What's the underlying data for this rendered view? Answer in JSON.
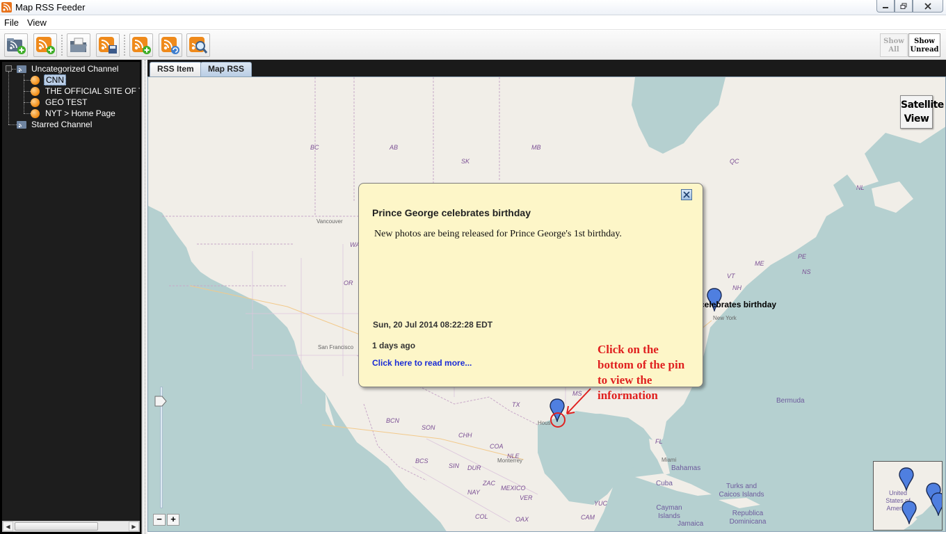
{
  "window": {
    "title": "Map RSS Feeder",
    "controls": [
      "minimize",
      "restore",
      "close"
    ]
  },
  "menu": [
    "File",
    "View"
  ],
  "toolbar": {
    "buttons": [
      {
        "icon": "add-channel-icon"
      },
      {
        "icon": "add-feed-icon"
      },
      {
        "icon": "open-folder-icon"
      },
      {
        "icon": "save-feed-icon"
      },
      {
        "icon": "feed-add-item-icon"
      },
      {
        "icon": "refresh-feed-icon"
      },
      {
        "icon": "search-feed-icon"
      }
    ],
    "show_all": "Show All",
    "show_unread": "Show Unread"
  },
  "tree": {
    "channels": [
      {
        "label": "Uncategorized Channel",
        "feeds": [
          "CNN",
          "THE OFFICIAL SITE OF T",
          "GEO TEST",
          "NYT > Home Page"
        ]
      },
      {
        "label": "Starred Channel",
        "feeds": []
      }
    ],
    "selected": "CNN"
  },
  "tabs": [
    {
      "label": "RSS Item",
      "active": false
    },
    {
      "label": "Map RSS",
      "active": true
    }
  ],
  "map": {
    "satellite_label_1": "Satellite",
    "satellite_label_2": "View",
    "labels": {
      "bc": "BC",
      "ab": "AB",
      "sk": "SK",
      "mb": "MB",
      "qc": "QC",
      "nl": "NL",
      "pe": "PE",
      "me": "ME",
      "ns": "NS",
      "vt": "VT",
      "nh": "NH",
      "or": "OR",
      "wa": "WA",
      "tx": "TX",
      "fl": "FL",
      "bcn": "BCN",
      "son": "SON",
      "chh": "CHH",
      "coa": "COA",
      "nle": "NLE",
      "bcs": "BCS",
      "sin": "SIN",
      "dur": "DUR",
      "zac": "ZAC",
      "nay": "NAY",
      "mexico": "MEXICO",
      "ver": "VER",
      "col": "COL",
      "oax": "OAX",
      "yuc": "YUC",
      "cam": "CAM",
      "ms": "MS",
      "vancouver": "Vancouver",
      "san_francisco": "San Francisco",
      "monterrey": "Monterrey",
      "miami": "Miami",
      "new_york": "New York",
      "houston": "Hous",
      "bermuda": "Bermuda",
      "bahamas": "Bahamas",
      "cuba": "Cuba",
      "turks": "Turks and Caicos Islands",
      "cayman": "Cayman Islands",
      "jamaica": "Jamaica",
      "dominicana": "Republica Dominicana"
    },
    "pin_label": "e celebrates birthday",
    "minimap_label": "United States of America"
  },
  "popup": {
    "title": "Prince George celebrates birthday",
    "description": "New photos are being released for Prince George's 1st birthday.",
    "date": "Sun, 20 Jul 2014 08:22:28 EDT",
    "ago": "1 days ago",
    "link": "Click here to read more..."
  },
  "annotation": {
    "lines": [
      "Click on the",
      "bottom of the pin",
      "to view the",
      "information"
    ],
    "color": "#e0201f"
  },
  "zoom": {
    "minus": "−",
    "plus": "+"
  },
  "colors": {
    "pin": "#4f7fe0",
    "popup_bg": "#fdf6c8",
    "ocean": "#b5d0d0",
    "land": "#f1eee8"
  }
}
